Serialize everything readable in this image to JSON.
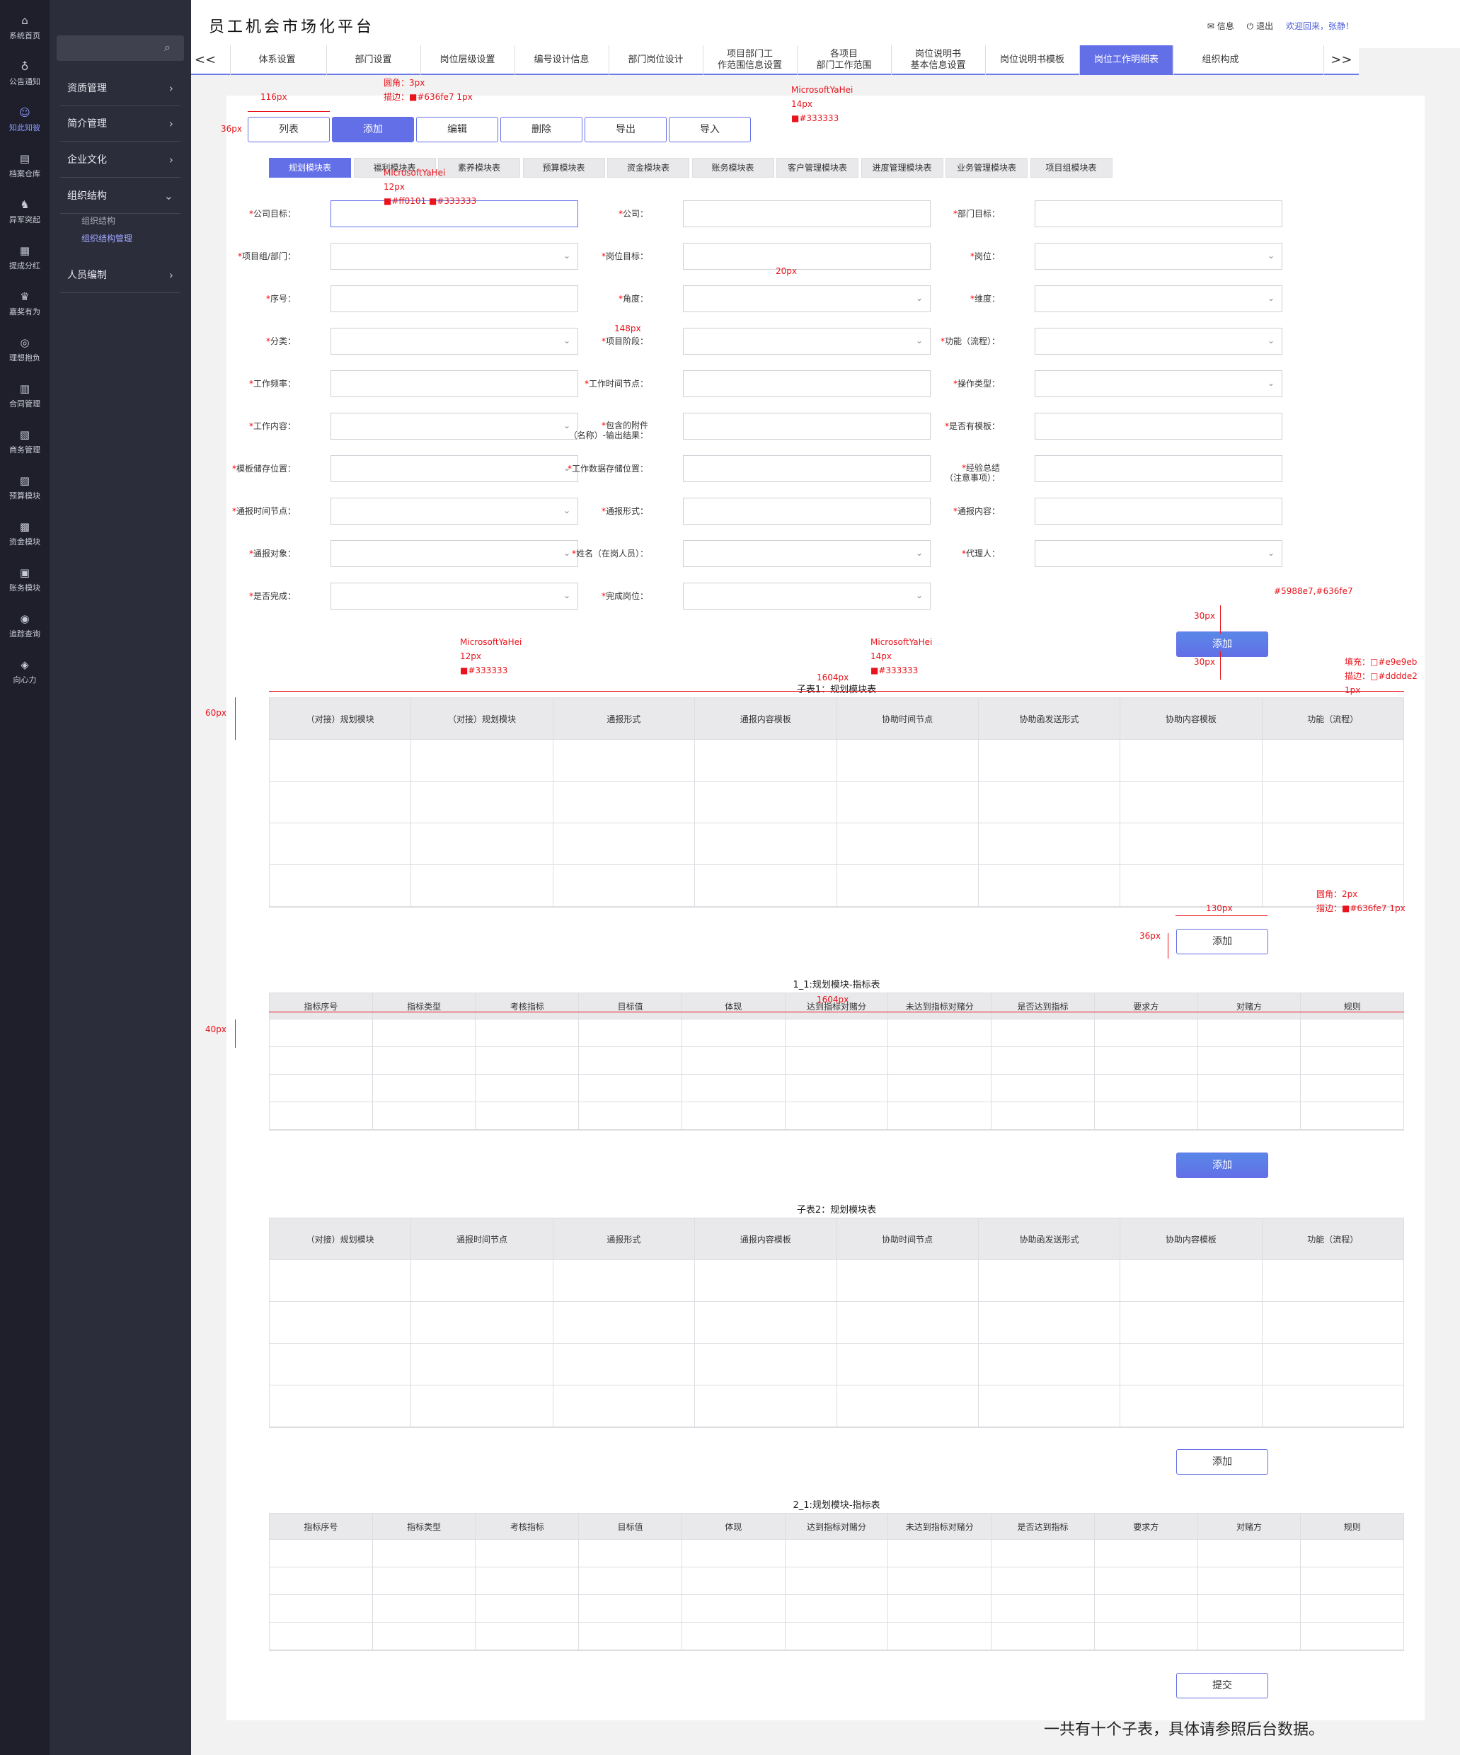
{
  "app": {
    "title": "员工机会市场化平台"
  },
  "header": {
    "info": "信息",
    "logout": "退出",
    "welcome": "欢迎回来，张静！"
  },
  "iconbar": [
    {
      "label": "系统首页",
      "icon": "home-icon",
      "glyph": "⌂"
    },
    {
      "label": "公告通知",
      "icon": "bell-icon",
      "glyph": "♁"
    },
    {
      "label": "知此知彼",
      "icon": "people-icon",
      "glyph": "☺"
    },
    {
      "label": "档案仓库",
      "icon": "archive-icon",
      "glyph": "▤"
    },
    {
      "label": "异军突起",
      "icon": "rocket-icon",
      "glyph": "♞"
    },
    {
      "label": "提成分红",
      "icon": "share-icon",
      "glyph": "▦"
    },
    {
      "label": "嘉奖有为",
      "icon": "trophy-icon",
      "glyph": "♛"
    },
    {
      "label": "理想抱负",
      "icon": "target-icon",
      "glyph": "◎"
    },
    {
      "label": "合同管理",
      "icon": "contract-icon",
      "glyph": "▥"
    },
    {
      "label": "商务管理",
      "icon": "business-icon",
      "glyph": "▧"
    },
    {
      "label": "预算模块",
      "icon": "budget-icon",
      "glyph": "▨"
    },
    {
      "label": "资金模块",
      "icon": "money-icon",
      "glyph": "▩"
    },
    {
      "label": "账务模块",
      "icon": "ledger-icon",
      "glyph": "▣"
    },
    {
      "label": "追踪查询",
      "icon": "track-icon",
      "glyph": "◉"
    },
    {
      "label": "向心力",
      "icon": "center-icon",
      "glyph": "◈"
    }
  ],
  "sidebar": {
    "items": [
      {
        "label": "资质管理",
        "chev": "›"
      },
      {
        "label": "简介管理",
        "chev": "›"
      },
      {
        "label": "企业文化",
        "chev": "›"
      },
      {
        "label": "组织结构",
        "chev": "⌄"
      },
      {
        "label": "人员编制",
        "chev": "›"
      }
    ],
    "subs": [
      "组织结构",
      "组织结构管理"
    ]
  },
  "tabs": {
    "prev": "<<",
    "next": ">>",
    "items": [
      {
        "l1": "体系设置",
        "l2": ""
      },
      {
        "l1": "部门设置",
        "l2": ""
      },
      {
        "l1": "岗位层级设置",
        "l2": ""
      },
      {
        "l1": "编号设计信息",
        "l2": ""
      },
      {
        "l1": "部门岗位设计",
        "l2": ""
      },
      {
        "l1": "项目部门工",
        "l2": "作范围信息设置"
      },
      {
        "l1": "各项目",
        "l2": "部门工作范围"
      },
      {
        "l1": "岗位说明书",
        "l2": "基本信息设置"
      },
      {
        "l1": "岗位说明书模板",
        "l2": ""
      },
      {
        "l1": "岗位工作明细表",
        "l2": ""
      },
      {
        "l1": "组织构成",
        "l2": ""
      }
    ]
  },
  "toolbar": [
    "列表",
    "添加",
    "编辑",
    "删除",
    "导出",
    "导入"
  ],
  "module_tabs": [
    "规划模块表",
    "福利模块表",
    "素养模块表",
    "预算模块表",
    "资金模块表",
    "账务模块表",
    "客户管理模块表",
    "进度管理模块表",
    "业务管理模块表",
    "项目组模块表"
  ],
  "form": {
    "rows": [
      [
        {
          "label": "公司目标：",
          "dd": false
        },
        {
          "label": "公司：",
          "dd": false
        },
        {
          "label": "部门目标：",
          "dd": false
        }
      ],
      [
        {
          "label": "项目组/部门：",
          "dd": true
        },
        {
          "label": "岗位目标：",
          "dd": false
        },
        {
          "label": "岗位：",
          "dd": true
        }
      ],
      [
        {
          "label": "序号：",
          "dd": false
        },
        {
          "label": "角度：",
          "dd": true
        },
        {
          "label": "维度：",
          "dd": true
        }
      ],
      [
        {
          "label": "分类：",
          "dd": true
        },
        {
          "label": "项目阶段：",
          "dd": true
        },
        {
          "label": "功能（流程）：",
          "dd": true
        }
      ],
      [
        {
          "label": "工作频率：",
          "dd": false
        },
        {
          "label": "工作时间节点：",
          "dd": false
        },
        {
          "label": "操作类型：",
          "dd": true
        }
      ],
      [
        {
          "label": "工作内容：",
          "dd": true
        },
        {
          "label": "包含的附件\n（名称）-输出结果：",
          "dd": false
        },
        {
          "label": "是否有模板：",
          "dd": false
        }
      ],
      [
        {
          "label": "模板储存位置：",
          "dd": true
        },
        {
          "label": "工作数据存储位置：",
          "dd": false
        },
        {
          "label": "经验总结\n（注意事项）：",
          "dd": false
        }
      ],
      [
        {
          "label": "通报时间节点：",
          "dd": true
        },
        {
          "label": "通报形式：",
          "dd": false
        },
        {
          "label": "通报内容：",
          "dd": false
        }
      ],
      [
        {
          "label": "通报对象：",
          "dd": true
        },
        {
          "label": "姓名（在岗人员）：",
          "dd": true
        },
        {
          "label": "代理人：",
          "dd": true
        }
      ],
      [
        {
          "label": "是否完成：",
          "dd": true
        },
        {
          "label": "完成岗位：",
          "dd": true
        }
      ]
    ],
    "add": "添加"
  },
  "table1": {
    "caption": "子表1：规划模块表",
    "headers": [
      "（对接）规划模块",
      "（对接）规划模块",
      "通报形式",
      "通报内容模板",
      "协助时间节点",
      "协助函发送形式",
      "协助内容模板",
      "功能（流程）"
    ],
    "rows": 4,
    "add": "添加"
  },
  "table1_1": {
    "caption": "1_1:规划模块-指标表",
    "headers": [
      "指标序号",
      "指标类型",
      "考核指标",
      "目标值",
      "体现",
      "达到指标对赌分",
      "未达到指标对赌分",
      "是否达到指标",
      "要求方",
      "对赌方",
      "规则"
    ],
    "rows": 4,
    "add": "添加"
  },
  "table2": {
    "caption": "子表2：规划模块表",
    "headers": [
      "（对接）规划模块",
      "通报时间节点",
      "通报形式",
      "通报内容模板",
      "协助时间节点",
      "协助函发送形式",
      "协助内容模板",
      "功能（流程）"
    ],
    "rows": 4,
    "add": "添加"
  },
  "table2_1": {
    "caption": "2_1:规划模块-指标表",
    "headers": [
      "指标序号",
      "指标类型",
      "考核指标",
      "目标值",
      "体现",
      "达到指标对赌分",
      "未达到指标对赌分",
      "是否达到指标",
      "要求方",
      "对赌方",
      "规则"
    ],
    "rows": 4
  },
  "submit": "提交",
  "footer_note": "一共有十个子表，具体请参照后台数据。",
  "annotations": [
    "116px",
    "36px",
    "圆角：3px",
    "描边：■#636fe7  1px",
    "MicrosoftYaHei",
    "14px",
    "■#333333",
    "MicrosoftYaHei",
    "12px",
    "■#ff0101  ■#333333",
    "20px",
    "148px",
    "#5988e7,#636fe7",
    "30px",
    "30px",
    "MicrosoftYaHei",
    "12px",
    "■#333333",
    "MicrosoftYaHei",
    "14px",
    "■#333333",
    "1604px",
    "填充：□#e9e9eb",
    "描边：□#dddde2  1px",
    "60px",
    "130px",
    "圆角：2px",
    "描边：■#636fe7  1px",
    "36px",
    "1604px",
    "40px"
  ],
  "colors": {
    "accent": "#636fe7",
    "gradient_start": "#5988e7",
    "required": "#ff0101",
    "text": "#333333",
    "header_fill": "#e9e9eb",
    "border": "#dddde2",
    "annotation": "#e8131b"
  }
}
